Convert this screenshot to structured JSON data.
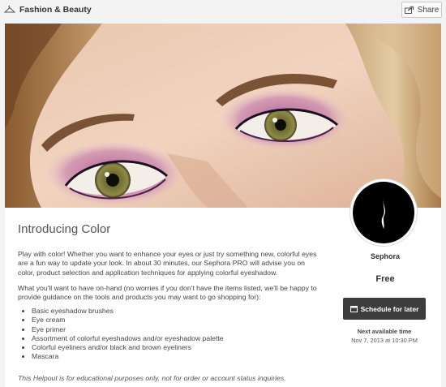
{
  "header": {
    "category": "Fashion & Beauty",
    "share_label": "Share"
  },
  "listing": {
    "title": "Introducing Color",
    "description": "Play with color! Whether you want to enhance your eyes or just try something new, colorful eyes are a fun way to update your look. In about 30 minutes, our Sephora PRO will advise you on color, product selection and application techniques for applying colorful eyeshadow.",
    "onhand_intro": "What you'll want to have on-hand (no worries if you don't have the items listed, we'll be happy to provide guidance on the tools and products you may want to go shopping for):",
    "items": [
      "Basic eyeshadow brushes",
      "Eye cream",
      "Eye primer",
      "Assortment of colorful eyeshadows and/or eyeshadow palette",
      "Colorful eyeliners and/or black and brown eyeliners",
      "Mascara"
    ],
    "disclaimer": "This Helpout is for educational purposes only, not for order or account status inquiries."
  },
  "provider": {
    "name": "Sephora",
    "price": "Free",
    "schedule_label": "Schedule for later",
    "next_label": "Next available time",
    "next_time": "Nov 7, 2013 at 10:30 PM"
  },
  "icons": {
    "category": "hanger-icon",
    "share": "share-icon",
    "schedule": "calendar-icon",
    "logo": "sephora-flame-logo"
  },
  "colors": {
    "button_bg": "#3d3d3d",
    "logo_bg": "#000000",
    "page_bg": "#f3f3f3",
    "eyeshadow": "#a0507f"
  }
}
